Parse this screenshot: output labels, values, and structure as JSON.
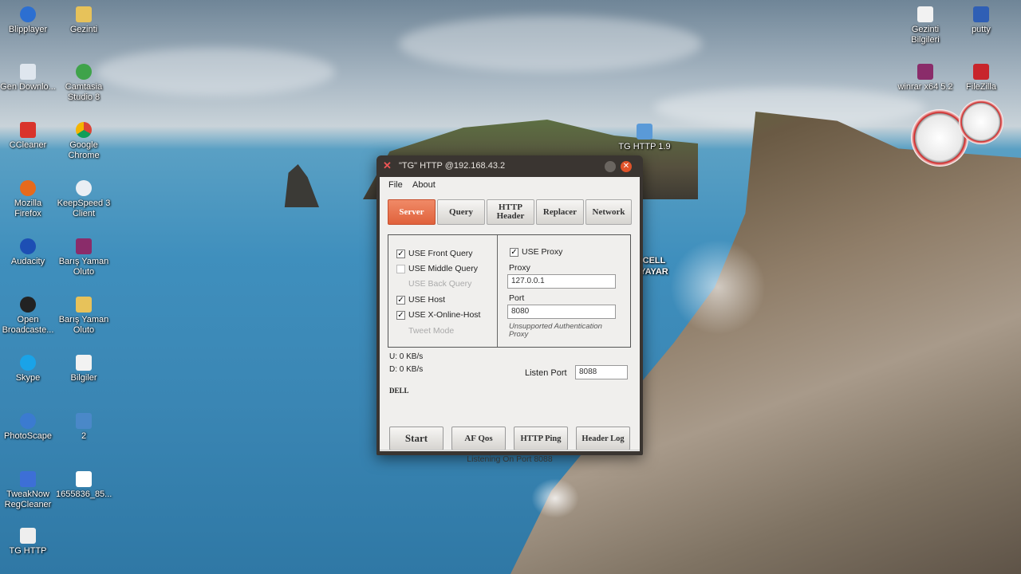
{
  "desktop": {
    "icons_left": [
      {
        "label": "Blipplayer"
      },
      {
        "label": "Gezinti"
      },
      {
        "label": "Gen Downlo..."
      },
      {
        "label": "Camtasia Studio 8"
      },
      {
        "label": "CCleaner"
      },
      {
        "label": "Google Chrome"
      },
      {
        "label": "Mozilla Firefox"
      },
      {
        "label": "KeepSpeed 3 Client"
      },
      {
        "label": "Audacity"
      },
      {
        "label": "Barış Yaman Oluto"
      },
      {
        "label": "Open Broadcaste..."
      },
      {
        "label": "Barış Yaman Oluto"
      },
      {
        "label": "Skype"
      },
      {
        "label": "Bilgiler"
      },
      {
        "label": "PhotoScape"
      },
      {
        "label": "2"
      },
      {
        "label": "TweakNow RegCleaner"
      },
      {
        "label": "1655836_85..."
      },
      {
        "label": "TG HTTP"
      }
    ],
    "icons_right": [
      {
        "label": "Gezinti Bilgileri"
      },
      {
        "label": "putty"
      },
      {
        "label": "winrar x64 5.2"
      },
      {
        "label": "FileZilla"
      }
    ],
    "wallpaper_labels": {
      "cell": "CELL",
      "yayar": "YAYAR"
    },
    "behind_window_icon": "TG HTTP 1.9"
  },
  "window": {
    "title": "\"TG\" HTTP @192.168.43.2",
    "menu": {
      "file": "File",
      "about": "About"
    },
    "tabs": [
      {
        "label": "Server",
        "active": true
      },
      {
        "label": "Query",
        "active": false
      },
      {
        "label": "HTTP Header",
        "active": false
      },
      {
        "label": "Replacer",
        "active": false
      },
      {
        "label": "Network",
        "active": false
      }
    ],
    "left_options": [
      {
        "label": "USE Front Query",
        "checked": true,
        "enabled": true
      },
      {
        "label": "USE Middle Query",
        "checked": false,
        "enabled": true
      },
      {
        "label": "USE Back Query",
        "checked": false,
        "enabled": false
      },
      {
        "label": "USE Host",
        "checked": true,
        "enabled": true
      },
      {
        "label": "USE X-Online-Host",
        "checked": true,
        "enabled": true
      },
      {
        "label": "Tweet Mode",
        "checked": false,
        "enabled": false
      }
    ],
    "proxy": {
      "use_proxy_label": "USE Proxy",
      "use_proxy_checked": true,
      "proxy_label": "Proxy",
      "proxy_value": "127.0.0.1",
      "port_label": "Port",
      "port_value": "8080",
      "note": "Unsupported Authentication Proxy"
    },
    "stats": {
      "upload": "U:   0 KB/s",
      "download": "D:   0 KB/s",
      "device": "DELL"
    },
    "listen_port_label": "Listen Port",
    "listen_port_value": "8088",
    "buttons": {
      "start": "Start",
      "af_qos": "AF Qos",
      "http_ping": "HTTP Ping",
      "header_log": "Header Log"
    },
    "status": "Listening On Port 8088"
  },
  "colors": {
    "active_tab": "#e0623c",
    "titlebar": "#3a3531",
    "close": "#e0532a"
  }
}
